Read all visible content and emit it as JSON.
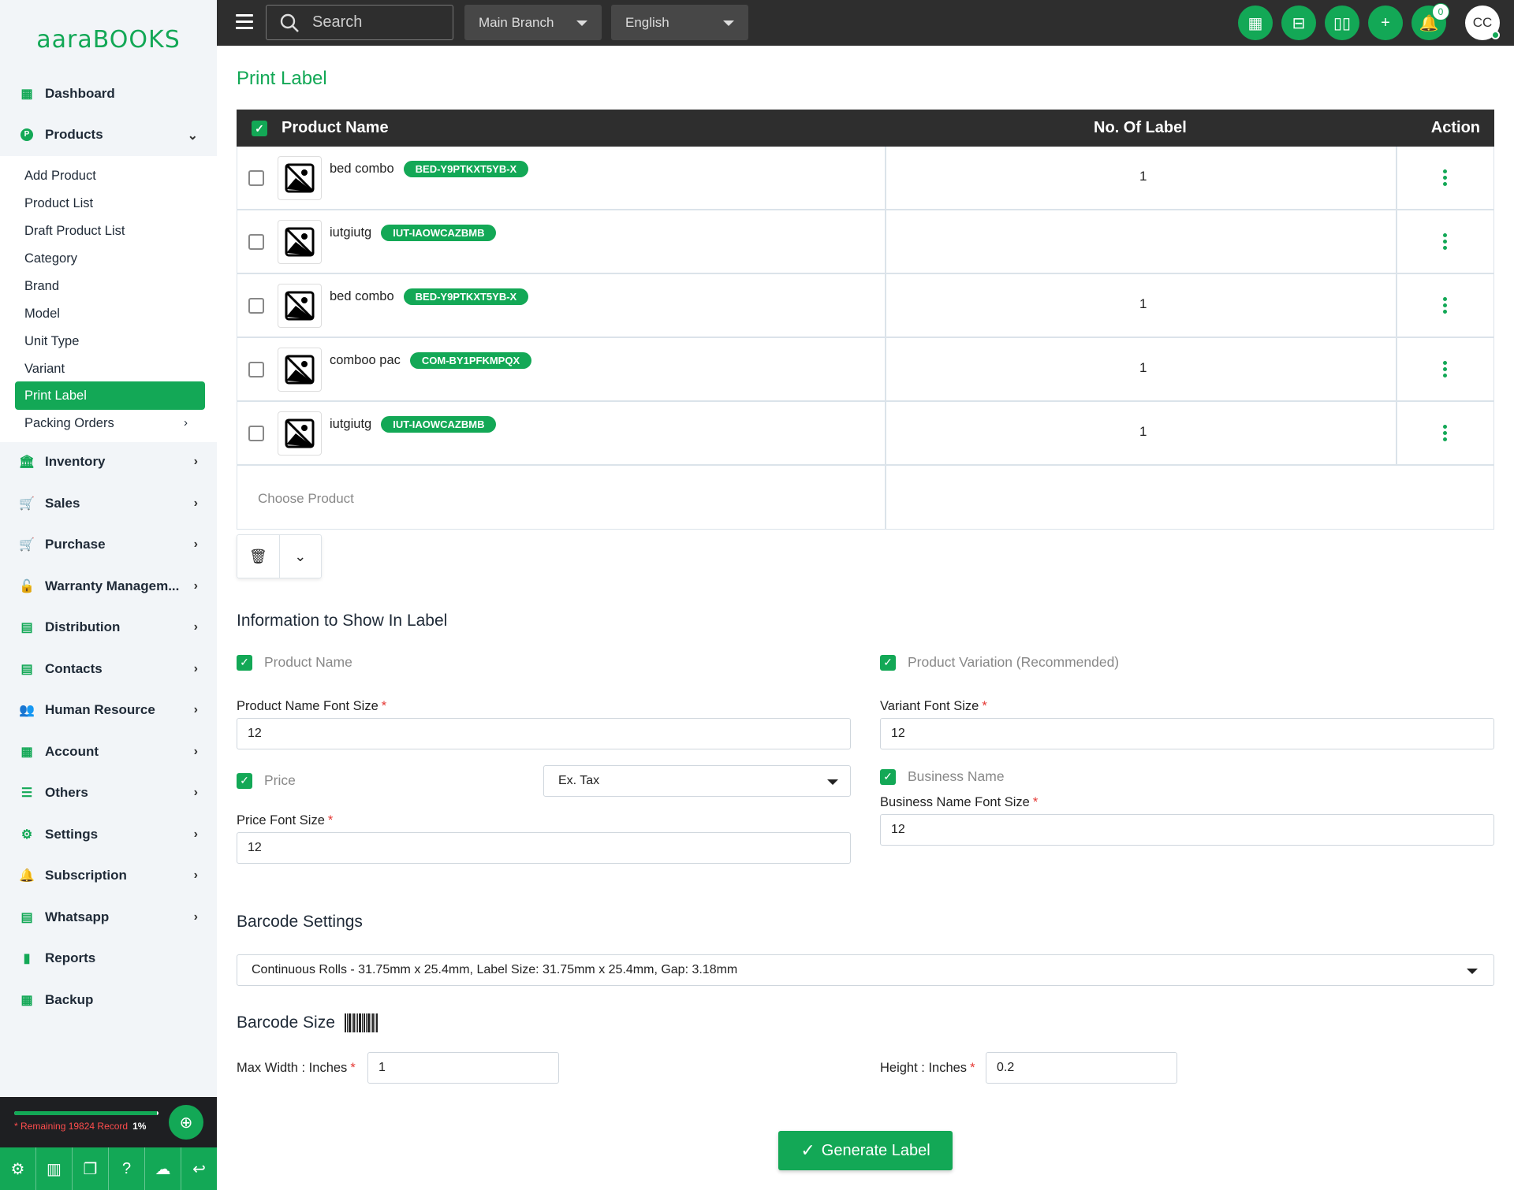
{
  "brand": {
    "name_part1": "aara",
    "name_part2": "BOOKS"
  },
  "topbar": {
    "search_placeholder": "Search",
    "branch": "Main Branch",
    "language": "English",
    "notification_count": "0",
    "avatar_initials": "CC",
    "buttons": [
      "calculator-icon",
      "scan-icon",
      "book-icon",
      "add-icon",
      "bell-icon"
    ]
  },
  "sidebar": {
    "dashboard": "Dashboard",
    "products": "Products",
    "product_sub": [
      "Add Product",
      "Product List",
      "Draft Product List",
      "Category",
      "Brand",
      "Model",
      "Unit Type",
      "Variant",
      "Print Label",
      "Packing Orders"
    ],
    "items": [
      "Inventory",
      "Sales",
      "Purchase",
      "Warranty Managem...",
      "Distribution",
      "Contacts",
      "Human Resource",
      "Account",
      "Others",
      "Settings",
      "Subscription",
      "Whatsapp",
      "Reports",
      "Backup"
    ],
    "footer": {
      "remaining_text": "* Remaining 19824 Record",
      "percent": "1%",
      "progress": 0.99
    }
  },
  "main": {
    "title": "Print Label",
    "table": {
      "headers": {
        "product_name": "Product Name",
        "no_of_label": "No. Of Label",
        "action": "Action"
      },
      "rows": [
        {
          "name": "bed combo",
          "sku": "BED-Y9PTKXT5YB-X",
          "qty": "1"
        },
        {
          "name": "iutgiutg",
          "sku": "IUT-IAOWCAZBMB",
          "qty": ""
        },
        {
          "name": "bed combo",
          "sku": "BED-Y9PTKXT5YB-X",
          "qty": "1"
        },
        {
          "name": "comboo pac",
          "sku": "COM-BY1PFKMPQX",
          "qty": "1"
        },
        {
          "name": "iutgiutg",
          "sku": "IUT-IAOWCAZBMB",
          "qty": "1"
        }
      ],
      "choose_placeholder": "Choose Product"
    },
    "info": {
      "title": "Information to Show In Label",
      "product_name_chk": "Product Name",
      "product_variation_chk": "Product Variation (Recommended)",
      "product_name_font_label": "Product Name Font Size",
      "product_name_font_value": "12",
      "variant_font_label": "Variant Font Size",
      "variant_font_value": "12",
      "price_chk": "Price",
      "price_tax_select": "Ex. Tax",
      "business_name_chk": "Business Name",
      "business_name_font_label": "Business Name Font Size",
      "business_name_font_value": "12",
      "price_font_label": "Price Font Size",
      "price_font_value": "12"
    },
    "barcode": {
      "settings_title": "Barcode Settings",
      "settings_value": "Continuous Rolls - 31.75mm x 25.4mm, Label Size: 31.75mm x 25.4mm, Gap: 3.18mm",
      "size_title": "Barcode Size",
      "max_width_label": "Max Width : Inches",
      "max_width_value": "1",
      "height_label": "Height : Inches",
      "height_value": "0.2"
    },
    "generate_button": "Generate Label"
  },
  "colors": {
    "accent": "#13a856",
    "topbar": "#2e2e2e",
    "sidebar": "#f2f5f8"
  }
}
